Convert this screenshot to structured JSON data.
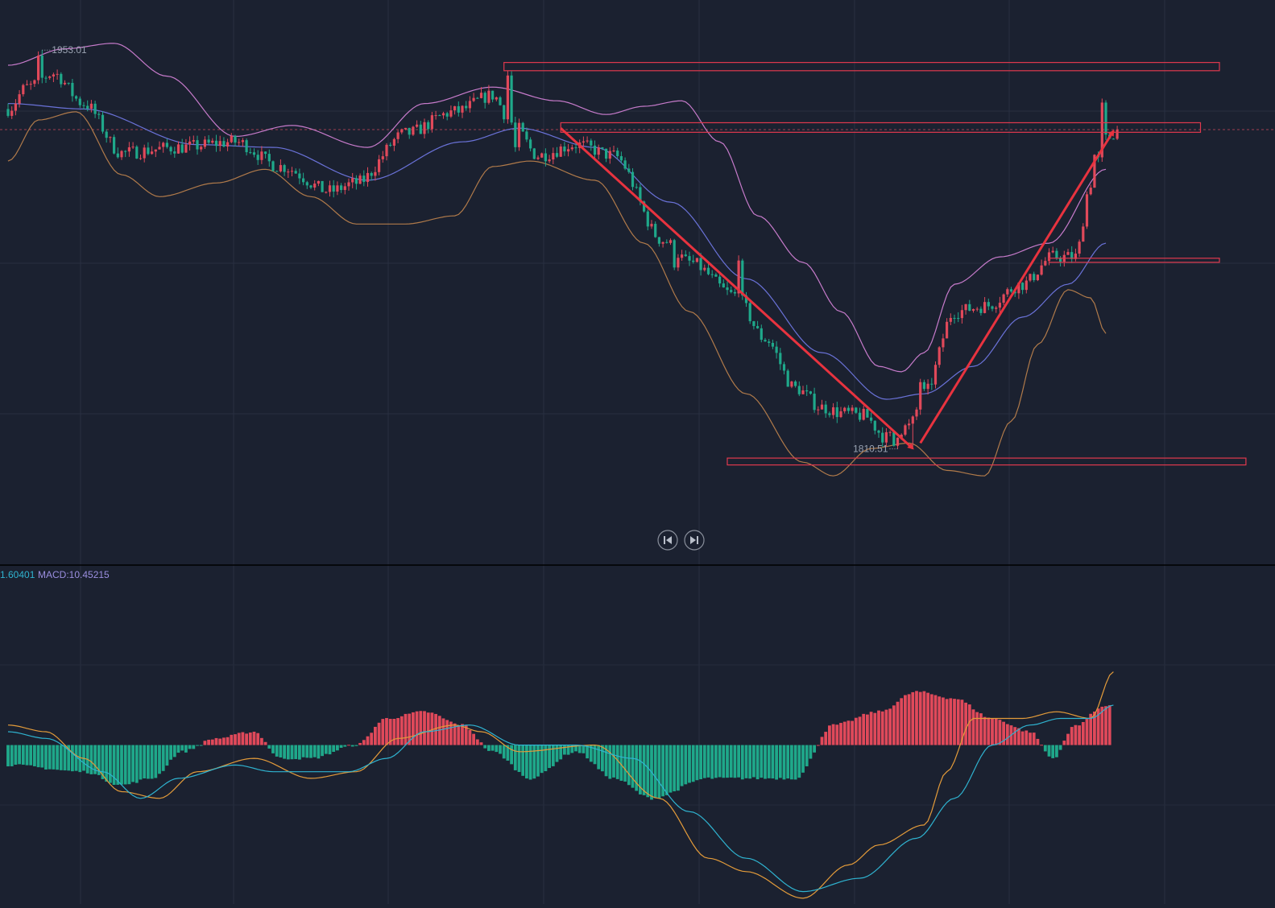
{
  "chart_data": [
    {
      "type": "candlestick",
      "name": "Price panel",
      "y_range": [
        1788,
        1965
      ],
      "bull_color": "#e0495a",
      "bear_color": "#1fa88a",
      "labels": {
        "high_marker": "1953.01",
        "low_marker": "1810.51"
      },
      "price_line": 1926.5,
      "anchors": [
        [
          0,
          1934
        ],
        [
          5,
          1942
        ],
        [
          12,
          1947
        ],
        [
          20,
          1936
        ],
        [
          30,
          1918
        ],
        [
          45,
          1920
        ],
        [
          60,
          1922
        ],
        [
          72,
          1913
        ],
        [
          85,
          1904
        ],
        [
          92,
          1907
        ],
        [
          105,
          1925
        ],
        [
          118,
          1933
        ],
        [
          128,
          1939
        ],
        [
          133,
          1929
        ],
        [
          140,
          1917
        ],
        [
          150,
          1921
        ],
        [
          160,
          1917
        ],
        [
          173,
          1886
        ],
        [
          180,
          1878
        ],
        [
          192,
          1866
        ],
        [
          200,
          1850
        ],
        [
          208,
          1832
        ],
        [
          215,
          1825
        ],
        [
          220,
          1823
        ],
        [
          226,
          1822
        ],
        [
          232,
          1814
        ],
        [
          238,
          1818
        ],
        [
          242,
          1830
        ],
        [
          250,
          1860
        ],
        [
          258,
          1862
        ],
        [
          268,
          1870
        ],
        [
          276,
          1880
        ],
        [
          282,
          1880
        ],
        [
          286,
          1907
        ],
        [
          290,
          1923
        ],
        [
          293,
          1926
        ]
      ],
      "candle_count": 294,
      "spikes": [
        {
          "i": 8,
          "dir": "up",
          "size": 9
        },
        {
          "i": 132,
          "dir": "up",
          "size": 16
        },
        {
          "i": 134,
          "dir": "down",
          "size": 9
        },
        {
          "i": 176,
          "dir": "down",
          "size": 10
        },
        {
          "i": 193,
          "dir": "up",
          "size": 12
        },
        {
          "i": 234,
          "dir": "down",
          "size": 5
        },
        {
          "i": 241,
          "dir": "up",
          "size": 10
        },
        {
          "i": 287,
          "dir": "up",
          "size": 12
        },
        {
          "i": 289,
          "dir": "up",
          "size": 20
        }
      ],
      "bollinger": {
        "middle_color": "#6a72d8",
        "upper_color": "#c77bcb",
        "lower_color": "#b07a4a",
        "middle": [
          [
            0,
            1936
          ],
          [
            20,
            1934
          ],
          [
            50,
            1921
          ],
          [
            70,
            1920
          ],
          [
            95,
            1908
          ],
          [
            120,
            1922
          ],
          [
            135,
            1927
          ],
          [
            155,
            1920
          ],
          [
            175,
            1900
          ],
          [
            195,
            1872
          ],
          [
            215,
            1845
          ],
          [
            232,
            1828
          ],
          [
            242,
            1830
          ],
          [
            255,
            1840
          ],
          [
            268,
            1858
          ],
          [
            280,
            1870
          ],
          [
            290,
            1885
          ]
        ],
        "upper": [
          [
            0,
            1950
          ],
          [
            15,
            1956
          ],
          [
            28,
            1958
          ],
          [
            42,
            1946
          ],
          [
            60,
            1924
          ],
          [
            75,
            1928
          ],
          [
            95,
            1920
          ],
          [
            110,
            1936
          ],
          [
            128,
            1942
          ],
          [
            145,
            1937
          ],
          [
            158,
            1932
          ],
          [
            168,
            1935
          ],
          [
            178,
            1937
          ],
          [
            188,
            1922
          ],
          [
            198,
            1895
          ],
          [
            210,
            1878
          ],
          [
            220,
            1860
          ],
          [
            230,
            1840
          ],
          [
            236,
            1838
          ],
          [
            242,
            1845
          ],
          [
            250,
            1870
          ],
          [
            262,
            1880
          ],
          [
            275,
            1885
          ],
          [
            290,
            1912
          ]
        ],
        "lower": [
          [
            0,
            1915
          ],
          [
            8,
            1930
          ],
          [
            18,
            1933
          ],
          [
            30,
            1910
          ],
          [
            40,
            1902
          ],
          [
            55,
            1907
          ],
          [
            68,
            1912
          ],
          [
            80,
            1902
          ],
          [
            92,
            1892
          ],
          [
            105,
            1892
          ],
          [
            118,
            1895
          ],
          [
            128,
            1913
          ],
          [
            138,
            1915
          ],
          [
            155,
            1908
          ],
          [
            168,
            1885
          ],
          [
            180,
            1860
          ],
          [
            195,
            1830
          ],
          [
            210,
            1805
          ],
          [
            218,
            1800
          ],
          [
            228,
            1810
          ],
          [
            238,
            1812
          ],
          [
            248,
            1802
          ],
          [
            258,
            1800
          ],
          [
            265,
            1820
          ],
          [
            272,
            1848
          ],
          [
            280,
            1868
          ],
          [
            286,
            1865
          ],
          [
            290,
            1852
          ]
        ]
      },
      "zones": [
        {
          "price_top": 1951,
          "price_bottom": 1948,
          "from": 131,
          "to": 320
        },
        {
          "price_top": 1929,
          "price_bottom": 1925.5,
          "from": 146,
          "to": 315
        },
        {
          "price_top": 1806.5,
          "price_bottom": 1804,
          "from": 190,
          "to": 327
        },
        {
          "price_top": 1879.5,
          "price_bottom": 1878,
          "from": 275,
          "to": 320
        }
      ],
      "arrows": [
        {
          "from": [
            146,
            1927
          ],
          "to": [
            239,
            1810
          ]
        },
        {
          "from": [
            241,
            1812
          ],
          "to": [
            292,
            1926
          ]
        }
      ]
    },
    {
      "type": "macd",
      "name": "MACD panel",
      "legend": {
        "dif_text": "1.60401",
        "macd_text": "MACD:10.45215"
      },
      "y_range": [
        -23.5,
        24
      ],
      "dif_color": "#2fb3d0",
      "dea_color": "#e39b3a",
      "hist_pos_color": "#e0495a",
      "hist_neg_color": "#1fa88a",
      "dif": [
        [
          0,
          2
        ],
        [
          10,
          1
        ],
        [
          25,
          -4
        ],
        [
          35,
          -8
        ],
        [
          45,
          -5
        ],
        [
          60,
          -3
        ],
        [
          70,
          -4
        ],
        [
          90,
          -4
        ],
        [
          100,
          -2
        ],
        [
          110,
          2
        ],
        [
          122,
          3
        ],
        [
          135,
          0
        ],
        [
          150,
          0
        ],
        [
          165,
          -2
        ],
        [
          180,
          -10
        ],
        [
          195,
          -17
        ],
        [
          210,
          -22
        ],
        [
          225,
          -20
        ],
        [
          240,
          -14
        ],
        [
          250,
          -8
        ],
        [
          260,
          0
        ],
        [
          270,
          3
        ],
        [
          278,
          4
        ],
        [
          286,
          4
        ],
        [
          292,
          6
        ]
      ],
      "dea": [
        [
          0,
          3
        ],
        [
          10,
          2
        ],
        [
          20,
          -2
        ],
        [
          30,
          -7
        ],
        [
          40,
          -8
        ],
        [
          50,
          -4
        ],
        [
          65,
          -2
        ],
        [
          80,
          -5
        ],
        [
          92,
          -4
        ],
        [
          103,
          1
        ],
        [
          118,
          3
        ],
        [
          125,
          2
        ],
        [
          135,
          -1
        ],
        [
          155,
          0
        ],
        [
          172,
          -8
        ],
        [
          185,
          -17
        ],
        [
          195,
          -19
        ],
        [
          210,
          -23
        ],
        [
          222,
          -18
        ],
        [
          230,
          -15
        ],
        [
          242,
          -12
        ],
        [
          248,
          -4
        ],
        [
          255,
          4
        ],
        [
          268,
          4
        ],
        [
          277,
          5
        ],
        [
          286,
          4
        ],
        [
          292,
          11
        ]
      ],
      "histogram_count": 292,
      "histogram": [
        [
          0,
          -3
        ],
        [
          20,
          -4
        ],
        [
          30,
          -6
        ],
        [
          38,
          -5
        ],
        [
          46,
          -1
        ],
        [
          55,
          1
        ],
        [
          65,
          2
        ],
        [
          72,
          -2
        ],
        [
          80,
          -2
        ],
        [
          92,
          0
        ],
        [
          100,
          4
        ],
        [
          110,
          5
        ],
        [
          120,
          3
        ],
        [
          128,
          -1
        ],
        [
          138,
          -5
        ],
        [
          150,
          -1
        ],
        [
          160,
          -5
        ],
        [
          170,
          -8
        ],
        [
          185,
          -5
        ],
        [
          195,
          -5
        ],
        [
          208,
          -5
        ],
        [
          218,
          3
        ],
        [
          230,
          5
        ],
        [
          240,
          8
        ],
        [
          250,
          7
        ],
        [
          260,
          4
        ],
        [
          270,
          2
        ],
        [
          276,
          -2
        ],
        [
          282,
          3
        ],
        [
          290,
          6
        ]
      ]
    }
  ],
  "controls": {
    "prev_icon": "skip-back-icon",
    "next_icon": "skip-forward-icon"
  }
}
